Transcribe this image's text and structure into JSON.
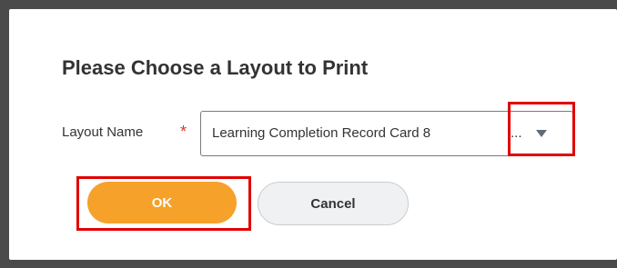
{
  "dialog": {
    "title": "Please Choose a Layout to Print"
  },
  "layout_field": {
    "label": "Layout Name",
    "required_marker": "*",
    "value": "Learning Completion Record Card 8",
    "truncation": "...",
    "dropdown_icon": "chevron-down-icon"
  },
  "buttons": {
    "ok_label": "OK",
    "cancel_label": "Cancel"
  },
  "annotations": {
    "highlight_color": "#e10000"
  },
  "colors": {
    "primary_button": "#f5a12a",
    "required_star": "#d9342b"
  }
}
